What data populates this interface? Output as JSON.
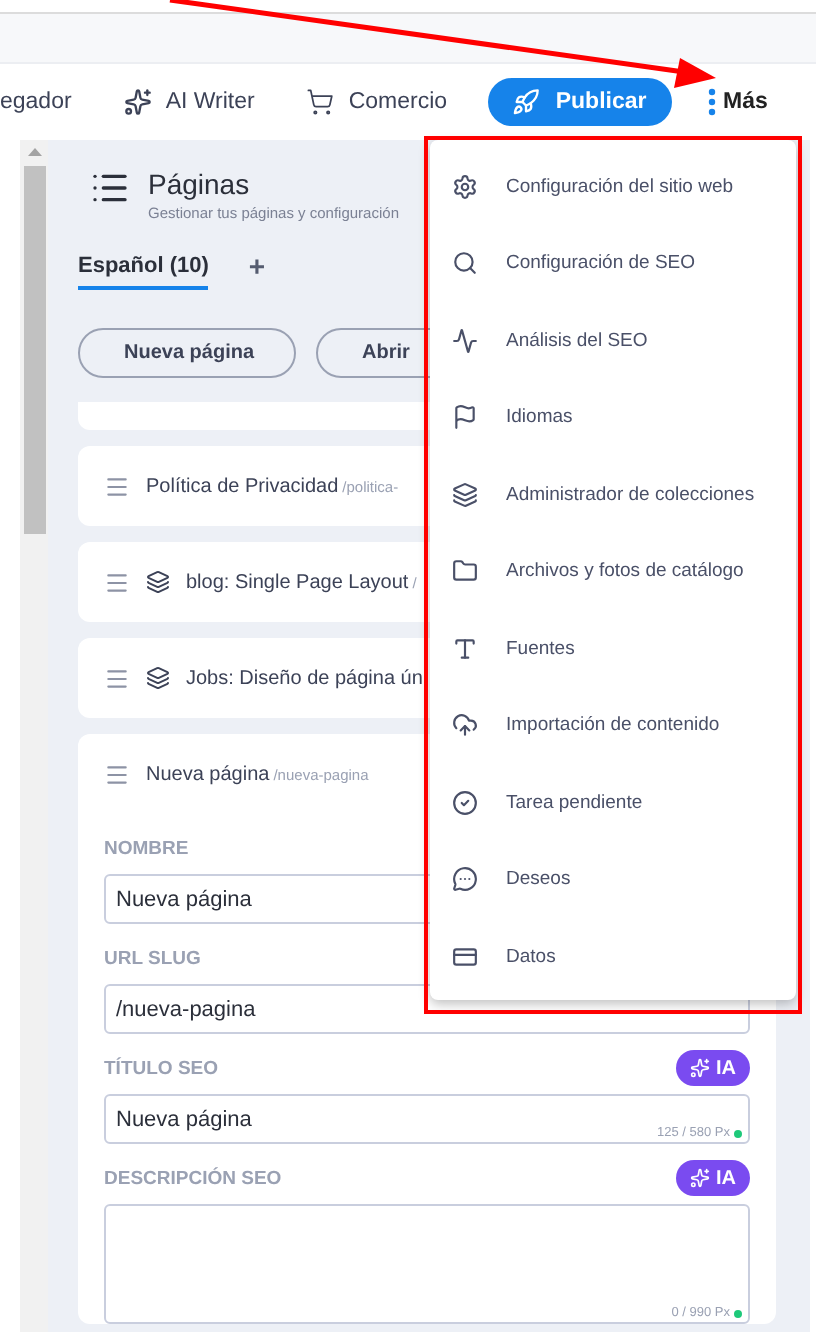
{
  "toolbar": {
    "items": [
      {
        "label": "egador",
        "kind": "text"
      },
      {
        "label": "AI Writer",
        "kind": "ai"
      },
      {
        "label": "Comercio",
        "kind": "cart"
      }
    ],
    "publish_button": "Publicar",
    "more_button": "Más"
  },
  "panel": {
    "title": "Páginas",
    "subtitle": "Gestionar tus páginas y configuración",
    "tabs": [
      {
        "label": "Español (10)",
        "selected": true
      }
    ],
    "add_tab": "+",
    "buttons": [
      "Nueva página",
      "Abrir"
    ],
    "pages": [
      {
        "title": "Política de Privacidad",
        "slug": "/politica-",
        "kind": "page",
        "expanded": false
      },
      {
        "title": "blog: Single Page Layout",
        "slug": "/",
        "kind": "collection",
        "expanded": false
      },
      {
        "title": "Jobs: Diseño de página ún",
        "kind": "collection",
        "expanded": false
      },
      {
        "title": "Nueva página",
        "slug": "/nueva-pagina",
        "kind": "page",
        "expanded": true
      }
    ],
    "form": [
      {
        "label": "NOMBRE",
        "value": "Nueva página",
        "kind": "input"
      },
      {
        "label": "URL SLUG",
        "value": "/nueva-pagina",
        "kind": "input"
      },
      {
        "label": "TÍTULO SEO",
        "value": "Nueva página",
        "kind": "input",
        "ai": "IA",
        "counter": "125 / 580 Px"
      },
      {
        "label": "DESCRIPCIÓN SEO",
        "kind": "textarea",
        "ai": "IA",
        "counter": "0 / 990 Px"
      }
    ]
  },
  "menu": {
    "items": [
      "Configuración del sitio web",
      "Configuración de SEO",
      "Análisis del SEO",
      "Idiomas",
      "Administrador de colecciones",
      "Archivos y fotos de catálogo",
      "Fuentes",
      "Importación de contenido",
      "Tarea pendiente",
      "Deseos",
      "Datos"
    ]
  }
}
